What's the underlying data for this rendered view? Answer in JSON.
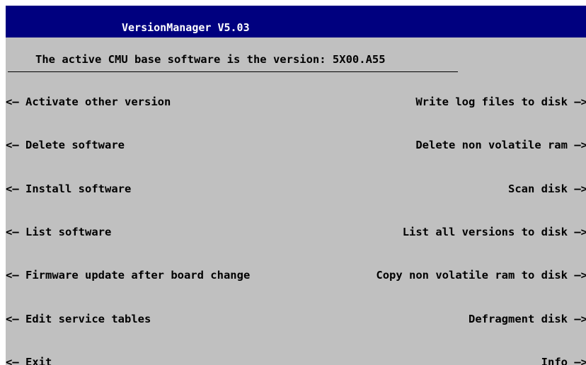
{
  "window": {
    "title": "VersionManager V5.03",
    "status_text": "The active CMU base software is the version: 5X00.A55"
  },
  "colors": {
    "background": "#c0c0c0",
    "titlebar": "#00007f",
    "title_text": "#ffffff",
    "text": "#000000"
  },
  "icons": {
    "left_arrow": "<—",
    "right_arrow": "—>"
  },
  "left_menu": [
    {
      "label": "Activate other version"
    },
    {
      "label": "Delete software"
    },
    {
      "label": "Install software"
    },
    {
      "label": "List software"
    },
    {
      "label": "Firmware update after board change"
    },
    {
      "label": "Edit service tables"
    },
    {
      "label": "Exit"
    }
  ],
  "right_menu": [
    {
      "label": "Write log files to disk"
    },
    {
      "label": "Delete non volatile ram"
    },
    {
      "label": "Scan disk"
    },
    {
      "label": "List all versions to disk"
    },
    {
      "label": "Copy non volatile ram to disk"
    },
    {
      "label": "Defragment disk"
    },
    {
      "label": "Info"
    }
  ]
}
